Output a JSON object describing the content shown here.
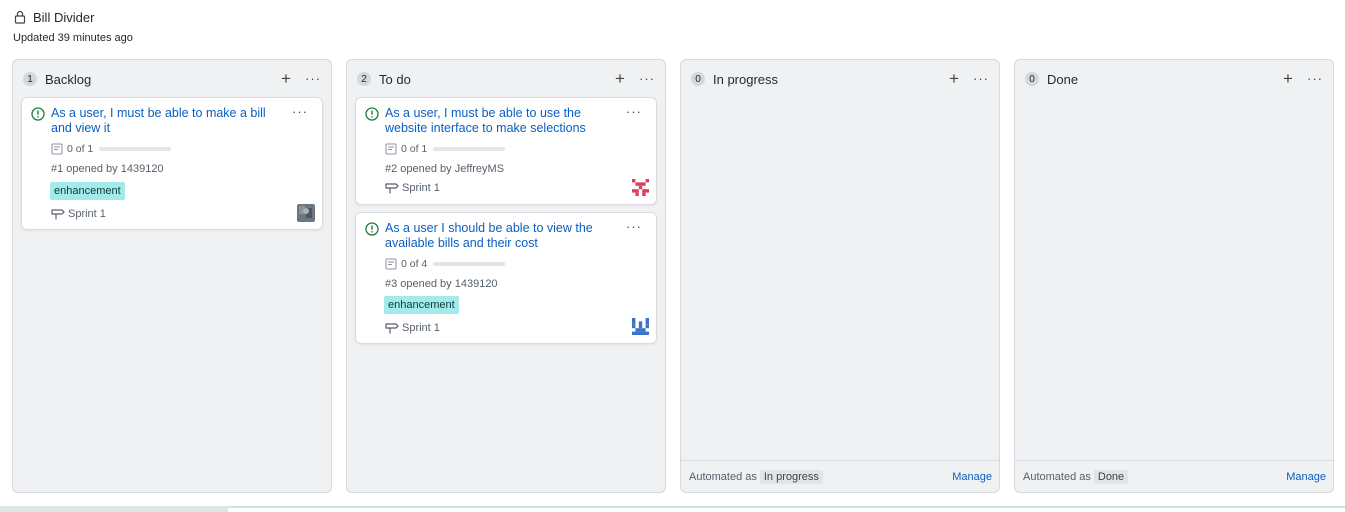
{
  "project": {
    "title": "Bill Divider",
    "updated": "Updated 39 minutes ago"
  },
  "columns": [
    {
      "name": "Backlog",
      "count": "1",
      "cards": [
        {
          "title": "As a user, I must be able to make a bill and view it",
          "tasks": "0 of 1",
          "tasks_progress": 0,
          "opened": "#1 opened by 1439120",
          "label": "enhancement",
          "milestone": "Sprint 1",
          "avatar": "photo-avatar"
        }
      ]
    },
    {
      "name": "To do",
      "count": "2",
      "cards": [
        {
          "title": "As a user, I must be able to use the website interface to make selections",
          "tasks": "0 of 1",
          "tasks_progress": 0,
          "opened": "#2 opened by JeffreyMS",
          "milestone": "Sprint 1",
          "avatar": "identicon-red"
        },
        {
          "title": "As a user I should be able to view the available bills and their cost",
          "tasks": "0 of 4",
          "tasks_progress": 0,
          "opened": "#3 opened by 1439120",
          "label": "enhancement",
          "milestone": "Sprint 1",
          "avatar": "identicon-blue"
        }
      ]
    },
    {
      "name": "In progress",
      "count": "0",
      "footer": {
        "automated_prefix": "Automated as",
        "automated_value": "In progress",
        "manage": "Manage"
      }
    },
    {
      "name": "Done",
      "count": "0",
      "footer": {
        "automated_prefix": "Automated as",
        "automated_value": "Done",
        "manage": "Manage"
      }
    }
  ],
  "colors": {
    "link": "#0a5fc2",
    "issue_open": "#1a7f37",
    "label_bg": "#a3eaea",
    "column_bg": "#f0f1f3"
  },
  "icons": {
    "lock": "lock-icon",
    "issue": "issue-opened-icon",
    "tasks": "checklist-icon",
    "milestone": "milestone-icon",
    "add": "plus-icon",
    "menu": "kebab-icon"
  }
}
